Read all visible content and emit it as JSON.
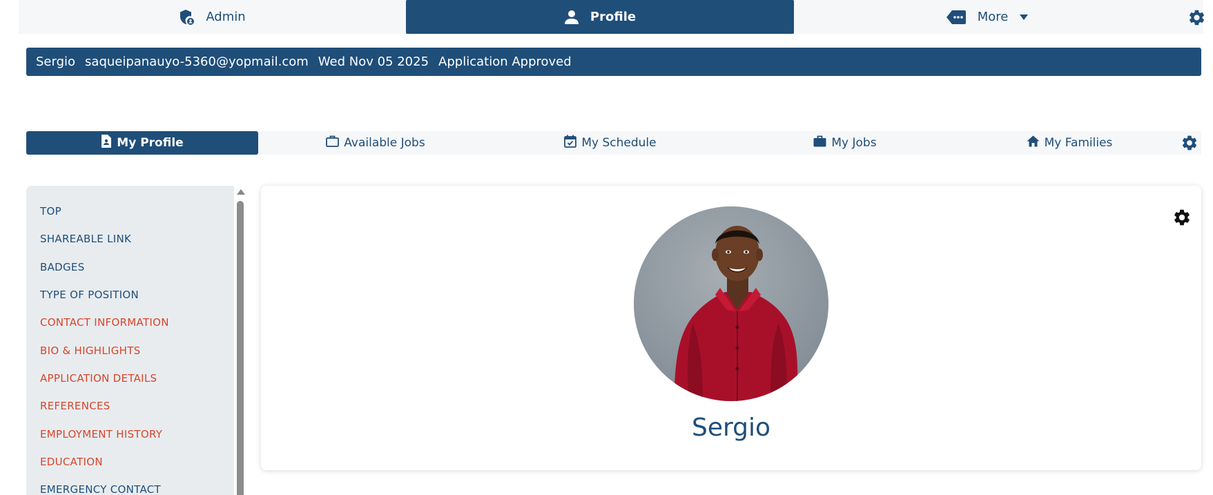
{
  "topnav": {
    "admin_label": "Admin",
    "profile_label": "Profile",
    "more_label": "More"
  },
  "infobar": {
    "name": "Sergio",
    "email": "saqueipanauyo-5360@yopmail.com",
    "date": "Wed Nov 05 2025",
    "status": "Application Approved"
  },
  "subtabs": {
    "my_profile": "My Profile",
    "available_jobs": "Available Jobs",
    "my_schedule": "My Schedule",
    "my_jobs": "My Jobs",
    "my_families": "My Families"
  },
  "sidebar": {
    "items": [
      {
        "label": "TOP",
        "state": "normal"
      },
      {
        "label": "SHAREABLE LINK",
        "state": "normal"
      },
      {
        "label": "BADGES",
        "state": "normal"
      },
      {
        "label": "TYPE OF POSITION",
        "state": "normal"
      },
      {
        "label": "CONTACT INFORMATION",
        "state": "alert"
      },
      {
        "label": "BIO & HIGHLIGHTS",
        "state": "alert"
      },
      {
        "label": "APPLICATION DETAILS",
        "state": "alert"
      },
      {
        "label": "REFERENCES",
        "state": "alert"
      },
      {
        "label": "EMPLOYMENT HISTORY",
        "state": "alert"
      },
      {
        "label": "EDUCATION",
        "state": "alert"
      },
      {
        "label": "EMERGENCY CONTACT",
        "state": "normal"
      }
    ]
  },
  "profile": {
    "name": "Sergio"
  },
  "colors": {
    "primary": "#1f4e79",
    "alert": "#d9442a",
    "nav_bg": "#f5f7f9",
    "sidebar_bg": "#e8ecef"
  },
  "icons": {
    "admin": "shield-user-icon",
    "profile": "user-icon",
    "more": "tag-dots-icon",
    "settings": "gear-icon"
  }
}
